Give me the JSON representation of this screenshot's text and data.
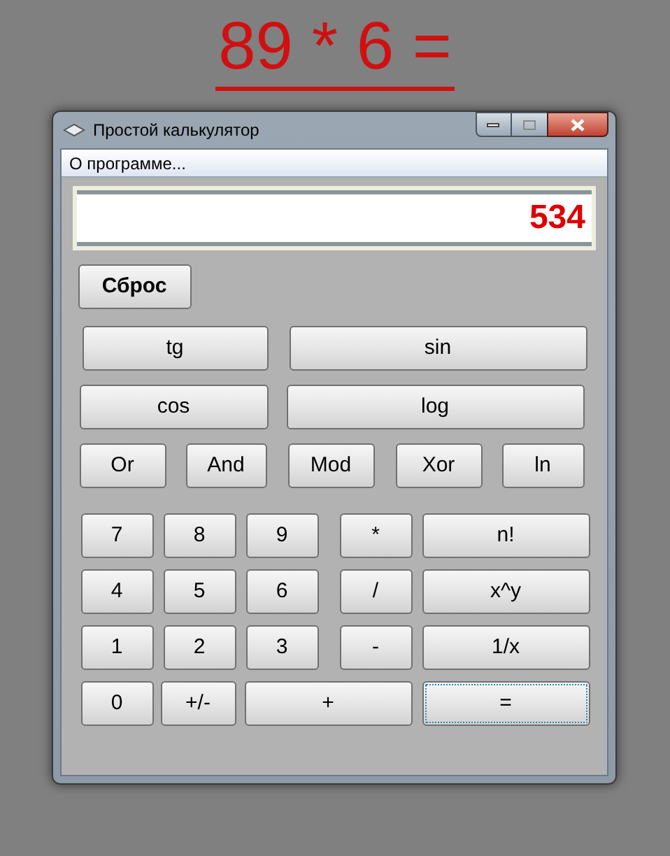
{
  "heading": "89 * 6 =",
  "window": {
    "title": "Простой калькулятор"
  },
  "menu": [
    {
      "label": "О программе..."
    }
  ],
  "display": {
    "value": "534"
  },
  "reset_button": {
    "label": "Сброс"
  },
  "function_rows": [
    [
      {
        "label": "tg"
      },
      {
        "label": "sin"
      }
    ],
    [
      {
        "label": "cos"
      },
      {
        "label": "log"
      }
    ],
    [
      {
        "label": "Or"
      },
      {
        "label": "And"
      },
      {
        "label": "Mod"
      },
      {
        "label": "Xor"
      },
      {
        "label": "ln"
      }
    ]
  ],
  "keypad_rows": [
    [
      {
        "label": "7",
        "focused": false
      },
      {
        "label": "8",
        "focused": false
      },
      {
        "label": "9",
        "focused": false
      },
      {
        "label": "*",
        "focused": false
      },
      {
        "label": "n!",
        "focused": false
      }
    ],
    [
      {
        "label": "4",
        "focused": false
      },
      {
        "label": "5",
        "focused": false
      },
      {
        "label": "6",
        "focused": false
      },
      {
        "label": "/",
        "focused": false
      },
      {
        "label": "x^y",
        "focused": false
      }
    ],
    [
      {
        "label": "1",
        "focused": false
      },
      {
        "label": "2",
        "focused": false
      },
      {
        "label": "3",
        "focused": false
      },
      {
        "label": "-",
        "focused": false
      },
      {
        "label": "1/x",
        "focused": false
      }
    ],
    [
      {
        "label": "0",
        "focused": false
      },
      {
        "label": "+/-",
        "focused": false
      },
      {
        "label": "+",
        "focused": false
      },
      {
        "label": "=",
        "focused": true
      }
    ]
  ]
}
